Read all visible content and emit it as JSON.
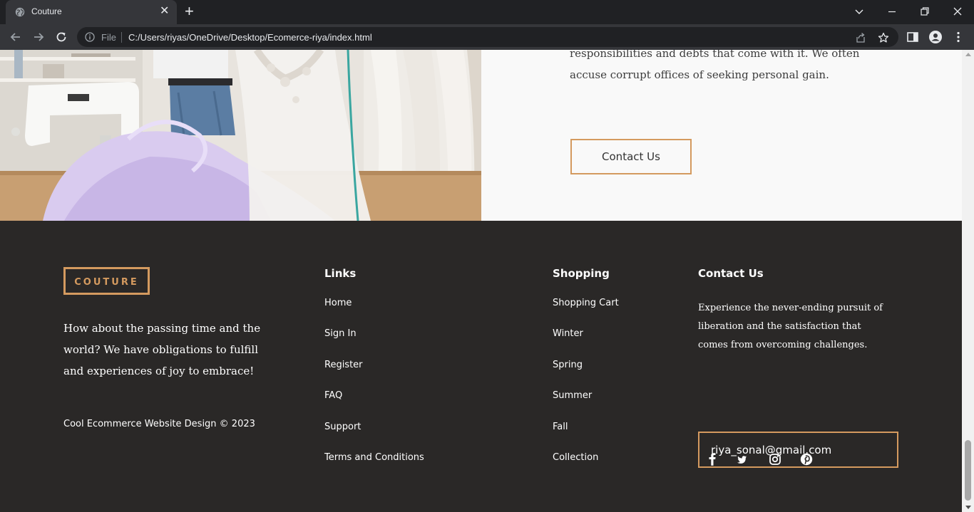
{
  "browser": {
    "tab_title": "Couture",
    "scheme_label": "File",
    "url": "C:/Users/riyas/OneDrive/Desktop/Ecomerce-riya/index.html"
  },
  "about": {
    "paragraph": "However, it is important to be mindful of the responsibilities and debts that come with it. We often accuse corrupt offices of seeking personal gain.",
    "button_label": "Contact Us"
  },
  "footer": {
    "logo": "COUTURE",
    "tagline": "How about the passing time and the world? We have obligations to fulfill and experiences of joy to embrace!",
    "copyright": "Cool Ecommerce Website Design © 2023",
    "links": {
      "title": "Links",
      "items": [
        "Home",
        "Sign In",
        "Register",
        "FAQ",
        "Support",
        "Terms and Conditions"
      ]
    },
    "shopping": {
      "title": "Shopping",
      "items": [
        "Shopping Cart",
        "Winter",
        "Spring",
        "Summer",
        "Fall",
        "Collection"
      ]
    },
    "contact": {
      "title": "Contact Us",
      "description": "Experience the never-ending pursuit of liberation and the satisfaction that comes from overcoming challenges.",
      "email_value": "riya_sonal@gmail.com"
    },
    "social_icons": [
      "facebook-icon",
      "twitter-icon",
      "instagram-icon",
      "pinterest-icon"
    ]
  },
  "colors": {
    "accent": "#d49a5f",
    "footer_bg": "#2a2827",
    "page_bg": "#f9f9f9",
    "chrome_dark": "#202124",
    "chrome_toolbar": "#35363a"
  }
}
